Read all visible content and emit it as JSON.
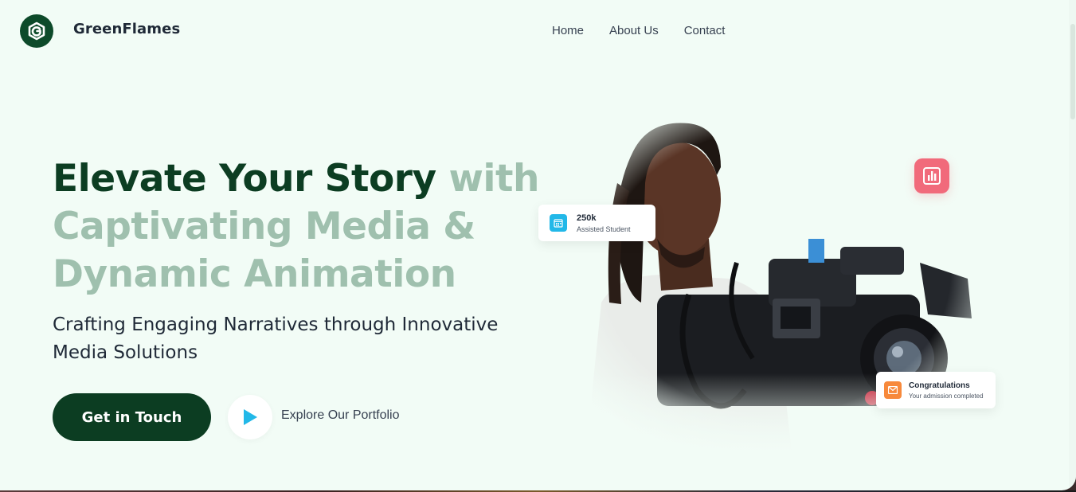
{
  "brand": {
    "name": "GreenFlames",
    "logo_letter": "G"
  },
  "nav": {
    "items": [
      "Home",
      "About Us",
      "Contact"
    ]
  },
  "hero": {
    "headline_dark": "Elevate Your Story",
    "headline_light": "with Captivating Media & Dynamic Animation",
    "subheadline": "Crafting Engaging Narratives through Innovative Media Solutions",
    "cta_label": "Get in Touch",
    "portfolio_label": "Explore Our Portfolio"
  },
  "cards": {
    "students": {
      "value": "250k",
      "label": "Assisted Student",
      "icon": "calendar-icon",
      "color": "#22b8e8"
    },
    "congrats": {
      "title": "Congratulations",
      "subtitle": "Your admission completed",
      "icon": "mail-icon",
      "color": "#f7893b"
    },
    "stats": {
      "icon": "bar-chart-icon",
      "color": "#f16a7b"
    }
  },
  "colors": {
    "brand_dark": "#0c3d22",
    "brand_light": "#9fc0ae",
    "background": "#f2fcf6",
    "play_accent": "#22b8e8"
  }
}
